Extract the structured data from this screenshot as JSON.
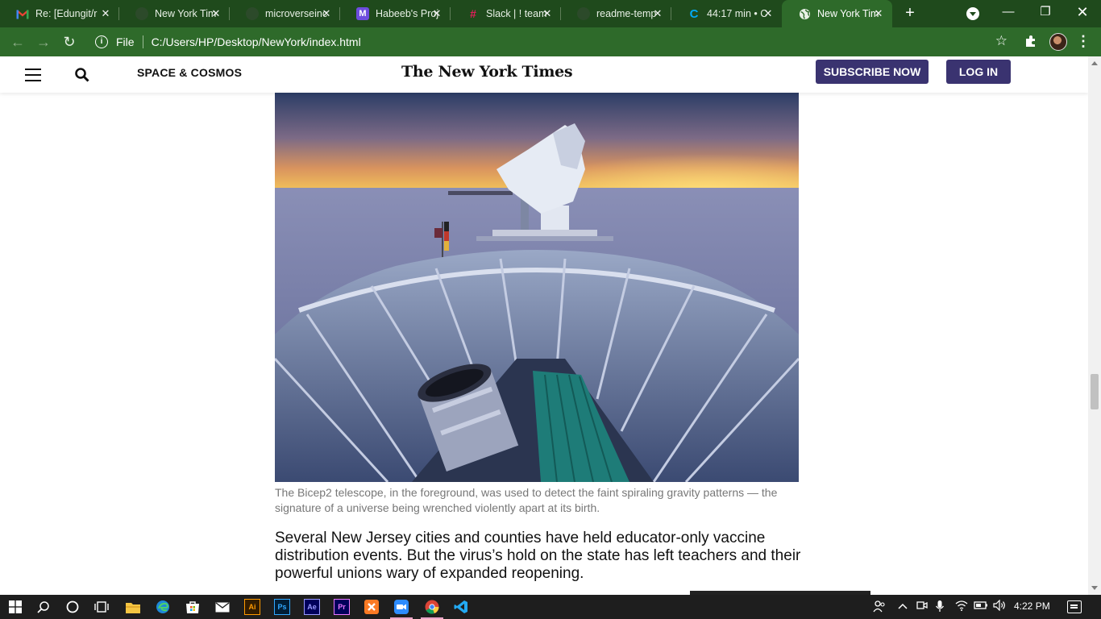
{
  "browser": {
    "tabs": [
      {
        "title": "Re: [Edungit/r",
        "favicon": "gmail-icon"
      },
      {
        "title": "New York Tim",
        "favicon": "github-icon"
      },
      {
        "title": "microverseinc",
        "favicon": "github-icon"
      },
      {
        "title": "Habeeb's Proj",
        "favicon": "miro-icon"
      },
      {
        "title": "Slack | ! team",
        "favicon": "slack-icon"
      },
      {
        "title": "readme-temp",
        "favicon": "github-icon"
      },
      {
        "title": "44:17 min • C",
        "favicon": "clockify-icon"
      },
      {
        "title": "New York Tim",
        "favicon": "globe-icon",
        "active": true
      }
    ],
    "address": {
      "scheme_label": "File",
      "url": "C:/Users/HP/Desktop/NewYork/index.html"
    }
  },
  "page": {
    "section": "SPACE & COSMOS",
    "masthead": "The New York Times",
    "subscribe_label": "SUBSCRIBE NOW",
    "login_label": "LOG IN",
    "caption": "The Bicep2 telescope, in the foreground, was used to detect the faint spiraling gravity patterns — the signature of a universe being wrenched violently apart at its birth.",
    "lede": "Several New Jersey cities and counties have held educator-only vaccine distribution events. But the virus’s hold on the state has left teachers and their powerful unions wary of expanded reopening."
  },
  "taskbar": {
    "apps": [
      "start",
      "search",
      "cortana",
      "task-view",
      "file-explorer",
      "edge",
      "store",
      "mail",
      "illustrator",
      "photoshop",
      "after-effects",
      "premiere",
      "xampp",
      "zoom",
      "chrome",
      "vscode"
    ],
    "app_labels": {
      "illustrator": "Ai",
      "photoshop": "Ps",
      "after_effects": "Ae",
      "premiere": "Pr"
    },
    "time": "4:22 PM"
  },
  "colors": {
    "tab_strip": "#1f4a1c",
    "toolbar": "#2e6a2a",
    "nyt_button": "#3a3370",
    "taskbar": "#1e1e1e"
  }
}
